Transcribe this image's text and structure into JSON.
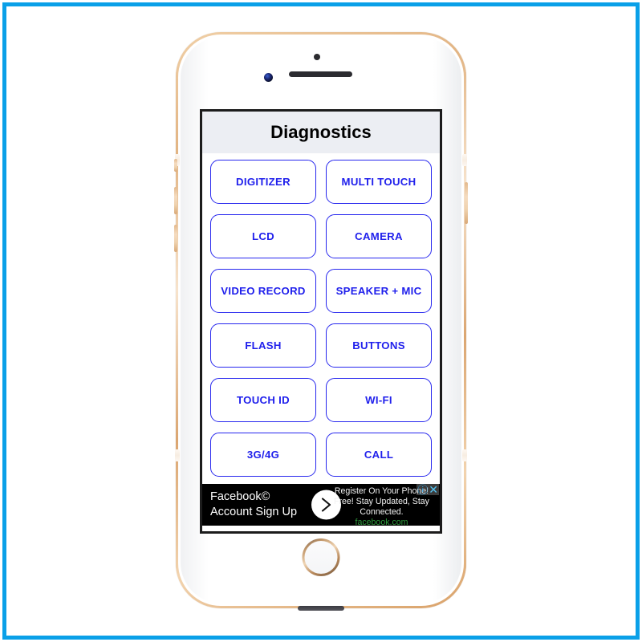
{
  "frame": {
    "border_color": "#0aa0e8",
    "background_color": "#ffffff"
  },
  "device": {
    "name": "iPhone",
    "body_color": "#ffffff",
    "rim_color": "#e2b483",
    "hardware": {
      "front_camera": "front-camera",
      "proximity_sensor": "proximity-sensor",
      "earpiece_speaker": "earpiece-speaker",
      "home_button": "home-button",
      "mute_switch": "mute-switch",
      "volume_up": "volume-up-button",
      "volume_down": "volume-down-button",
      "power_button": "power-button",
      "bottom_speaker": "bottom-speaker"
    }
  },
  "app": {
    "header": {
      "title": "Diagnostics",
      "background_color": "#eceef3",
      "text_color": "#000000"
    },
    "button_accent_color": "#2020ec",
    "buttons": [
      {
        "label": "DIGITIZER"
      },
      {
        "label": "MULTI TOUCH"
      },
      {
        "label": "LCD"
      },
      {
        "label": "CAMERA"
      },
      {
        "label": "VIDEO RECORD"
      },
      {
        "label": "SPEAKER + MIC"
      },
      {
        "label": "FLASH"
      },
      {
        "label": "BUTTONS"
      },
      {
        "label": "TOUCH ID"
      },
      {
        "label": "WI-FI"
      },
      {
        "label": "3G/4G"
      },
      {
        "label": "CALL"
      }
    ]
  },
  "ad": {
    "background_color": "#000000",
    "headline_line1": "Facebook©",
    "headline_line2": "Account Sign Up",
    "body_line1": "Register On Your Phone!",
    "body_line2": "Free! Stay Updated, Stay",
    "body_line3": "Connected.",
    "url": "facebook.com",
    "url_color": "#2f9a3c",
    "arrow_glyph": "chevron-right",
    "adchoices_glyph": "ⓘ",
    "close_glyph": "✕"
  }
}
